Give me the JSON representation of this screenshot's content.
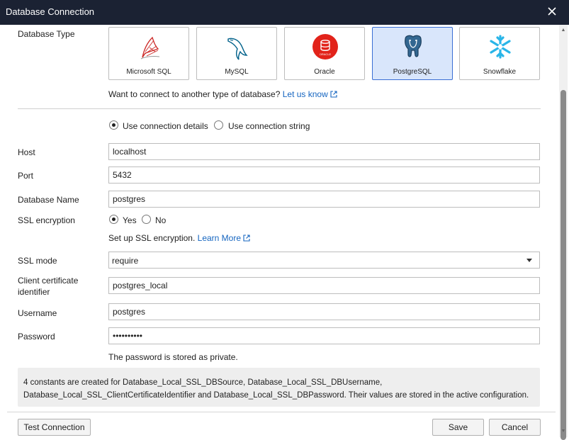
{
  "window": {
    "title": "Database Connection"
  },
  "database_type": {
    "label": "Database Type",
    "tiles": [
      {
        "label": "Microsoft SQL",
        "icon": "microsoft-sql-icon"
      },
      {
        "label": "MySQL",
        "icon": "mysql-dolphin-icon"
      },
      {
        "label": "Oracle",
        "icon": "oracle-icon",
        "icon_caption": "ORACLE"
      },
      {
        "label": "PostgreSQL",
        "icon": "postgresql-elephant-icon",
        "selected": true
      },
      {
        "label": "Snowflake",
        "icon": "snowflake-icon"
      }
    ],
    "other_prompt": "Want to connect to another type of database?",
    "other_link": "Let us know"
  },
  "connection_mode": {
    "details_label": "Use connection details",
    "string_label": "Use connection string",
    "selected": "details"
  },
  "fields": {
    "host_label": "Host",
    "host_value": "localhost",
    "port_label": "Port",
    "port_value": "5432",
    "dbname_label": "Database Name",
    "dbname_value": "postgres",
    "ssl_label": "SSL encryption",
    "ssl_yes": "Yes",
    "ssl_no": "No",
    "ssl_selected": "yes",
    "ssl_setup_text": "Set up SSL encryption.",
    "ssl_learn_more": "Learn More",
    "ssl_mode_label": "SSL mode",
    "ssl_mode_value": "require",
    "client_cert_label_1": "Client certificate",
    "client_cert_label_2": "identifier",
    "client_cert_value": "postgres_local",
    "username_label": "Username",
    "username_value": "postgres",
    "password_label": "Password",
    "password_value": "••••••••••",
    "password_note": "The password is stored as private."
  },
  "info_note": {
    "line1": "4 constants are created for Database_Local_SSL_DBSource, Database_Local_SSL_DBUsername,",
    "line2": "Database_Local_SSL_ClientCertificateIdentifier and Database_Local_SSL_DBPassword. Their values are stored in the active configuration."
  },
  "buttons": {
    "test_connection": "Test Connection",
    "save": "Save",
    "cancel": "Cancel"
  },
  "colors": {
    "titlebar": "#1b2233",
    "selected_tile_bg": "#d9e6fb",
    "selected_tile_border": "#3a6ed4",
    "link": "#1565c0",
    "oracle_red": "#e2231a",
    "snowflake_blue": "#29b5e8",
    "mssql_red": "#cc2927"
  }
}
